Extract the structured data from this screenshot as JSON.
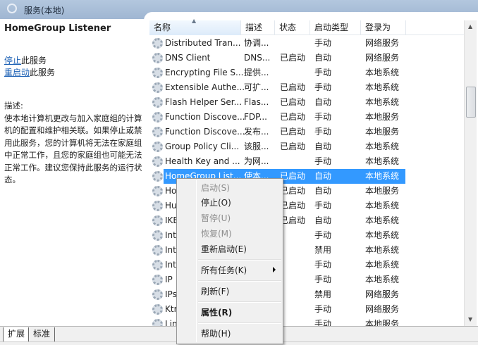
{
  "window": {
    "title": "服务(本地)"
  },
  "detail": {
    "service_name": "HomeGroup Listener",
    "stop_link": "停止",
    "stop_suffix": "此服务",
    "restart_link": "重启动",
    "restart_suffix": "此服务",
    "desc_label": "描述:",
    "description": "使本地计算机更改与加入家庭组的计算机的配置和维护相关联。如果停止或禁用此服务，您的计算机将无法在家庭组中正常工作，且您的家庭组也可能无法正常工作。建议您保持此服务的运行状态。"
  },
  "columns": [
    "名称",
    "描述",
    "状态",
    "启动类型",
    "登录为"
  ],
  "rows": [
    {
      "name": "Distributed Tran...",
      "desc": "协调...",
      "status": "",
      "startup": "手动",
      "logon": "网络服务"
    },
    {
      "name": "DNS Client",
      "desc": "DNS...",
      "status": "已启动",
      "startup": "自动",
      "logon": "网络服务"
    },
    {
      "name": "Encrypting File S...",
      "desc": "提供...",
      "status": "",
      "startup": "手动",
      "logon": "本地系统"
    },
    {
      "name": "Extensible Authe...",
      "desc": "可扩...",
      "status": "已启动",
      "startup": "手动",
      "logon": "本地系统"
    },
    {
      "name": "Flash Helper Ser...",
      "desc": "Flas...",
      "status": "已启动",
      "startup": "自动",
      "logon": "本地系统"
    },
    {
      "name": "Function Discove...",
      "desc": "FDP...",
      "status": "已启动",
      "startup": "手动",
      "logon": "本地服务"
    },
    {
      "name": "Function Discove...",
      "desc": "发布...",
      "status": "已启动",
      "startup": "手动",
      "logon": "本地服务"
    },
    {
      "name": "Group Policy Cli...",
      "desc": "该服...",
      "status": "已启动",
      "startup": "自动",
      "logon": "本地系统"
    },
    {
      "name": "Health Key and ...",
      "desc": "为网...",
      "status": "",
      "startup": "手动",
      "logon": "本地系统"
    },
    {
      "name": "HomeGroup List...",
      "desc": "使本...",
      "status": "已启动",
      "startup": "自动",
      "logon": "本地系统",
      "selected": true
    },
    {
      "name": "Ho",
      "desc": "",
      "status": "已启动",
      "startup": "自动",
      "logon": "本地服务"
    },
    {
      "name": "Hu",
      "desc": "",
      "status": "已启动",
      "startup": "手动",
      "logon": "本地系统"
    },
    {
      "name": "IKE",
      "desc": "",
      "status": "已启动",
      "startup": "自动",
      "logon": "本地系统"
    },
    {
      "name": "Int",
      "desc": "",
      "status": "",
      "startup": "手动",
      "logon": "本地系统"
    },
    {
      "name": "Int",
      "desc": "",
      "status": "",
      "startup": "禁用",
      "logon": "本地系统"
    },
    {
      "name": "Int",
      "desc": "",
      "status": "",
      "startup": "手动",
      "logon": "本地系统"
    },
    {
      "name": "IP",
      "desc": "",
      "status": "",
      "startup": "手动",
      "logon": "本地系统"
    },
    {
      "name": "IPs",
      "desc": "",
      "status": "",
      "startup": "禁用",
      "logon": "网络服务"
    },
    {
      "name": "Ktr",
      "desc": "",
      "status": "",
      "startup": "手动",
      "logon": "网络服务"
    },
    {
      "name": "Lin",
      "desc": "",
      "status": "",
      "startup": "手动",
      "logon": "本地服务"
    }
  ],
  "context_menu": {
    "start": "启动(S)",
    "stop": "停止(O)",
    "pause": "暂停(U)",
    "resume": "恢复(M)",
    "restart": "重新启动(E)",
    "all_tasks": "所有任务(K)",
    "refresh": "刷新(F)",
    "properties": "属性(R)",
    "help": "帮助(H)"
  },
  "tabs": [
    "扩展",
    "标准"
  ],
  "colors": {
    "selection": "#3399ff",
    "link": "#1a5fb4",
    "titlebar": "#a8bfd9"
  }
}
